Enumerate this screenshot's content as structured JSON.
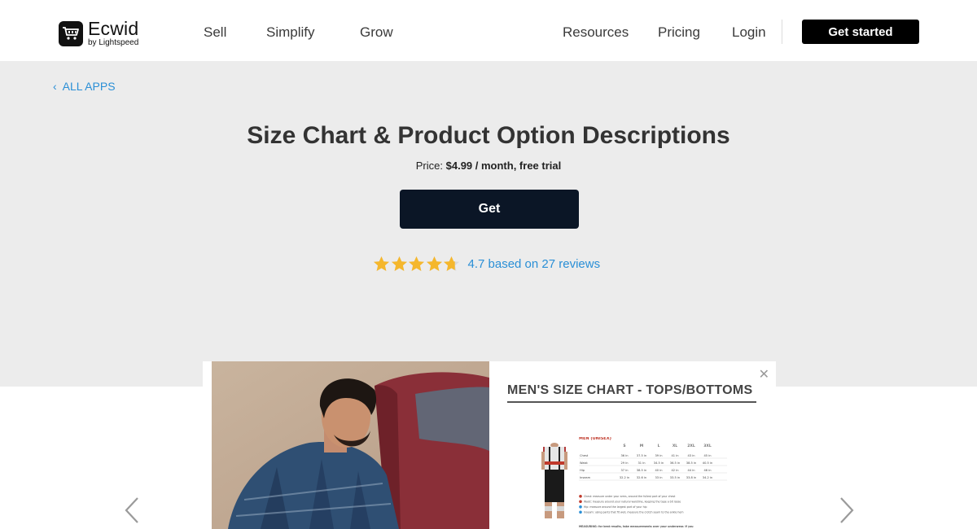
{
  "header": {
    "logo": {
      "name": "Ecwid",
      "sub": "by Lightspeed"
    },
    "nav": [
      {
        "label": "Sell"
      },
      {
        "label": "Simplify"
      },
      {
        "label": "Grow"
      }
    ],
    "right_nav": [
      {
        "label": "Resources"
      },
      {
        "label": "Pricing"
      },
      {
        "label": "Login"
      }
    ],
    "cta": "Get started"
  },
  "hero": {
    "back_label": "ALL APPS",
    "title": "Size Chart & Product Option Descriptions",
    "price_prefix": "Price:",
    "price_value": "$4.99 / month, free trial",
    "get_label": "Get",
    "rating_value": 4.7,
    "rating_text": "4.7 based on 27 reviews",
    "star_color": "#f5b72c"
  },
  "carousel": {
    "slide_title": "MEN'S SIZE CHART - TOPS/BOTTOMS",
    "chart_section": "MEN (UNISEX)",
    "sizes": [
      "S",
      "M",
      "L",
      "XL",
      "2XL",
      "3XL"
    ],
    "rows": [
      {
        "label": "Chest",
        "values": [
          "36 in",
          "37.5 in",
          "39 in",
          "41 in",
          "43 in",
          "45 in"
        ]
      },
      {
        "label": "Waist",
        "values": [
          "29 in",
          "31 in",
          "34.5 in",
          "36.5 in",
          "38.5 in",
          "40.5 in"
        ]
      },
      {
        "label": "Hip",
        "values": [
          "37 in",
          "38.5 in",
          "40 in",
          "42 in",
          "44 in",
          "46 in"
        ]
      },
      {
        "label": "Inseam",
        "values": [
          "32.2 in",
          "32.6 in",
          "33 in",
          "33.5 in",
          "33.8 in",
          "34.2 in"
        ]
      }
    ],
    "notes": [
      "Chest: measure under your arms, around the fullest part of your chest",
      "Waist: measure around your natural waistline, keeping the tape a bit loose",
      "Hip: measure around the largest part of your hip",
      "Inseam: using pants that fit well, measure the crotch seam to the ankle hem"
    ],
    "footer_note": "MEASURING: for best results, take measurements over your underwear. If you",
    "prev_icon": "chevron-left-icon",
    "next_icon": "chevron-right-icon"
  }
}
